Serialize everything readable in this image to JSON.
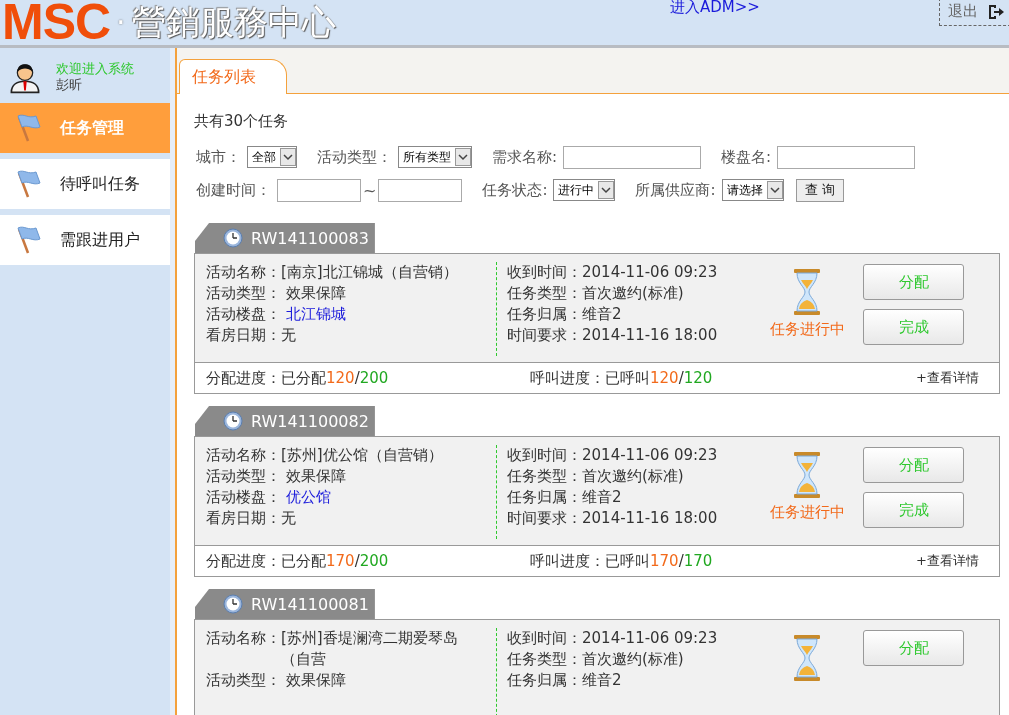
{
  "header": {
    "logo": "MSC",
    "separator": "·",
    "title": "營銷服務中心",
    "adm_link": "进入ADM>>",
    "logout": "退出"
  },
  "user": {
    "welcome": "欢迎进入系统",
    "name": "彭昕"
  },
  "menu": [
    {
      "label": "任务管理",
      "selected": true
    },
    {
      "label": "待呼叫任务",
      "selected": false
    },
    {
      "label": "需跟进用户",
      "selected": false
    }
  ],
  "tab": {
    "label": "任务列表"
  },
  "summary": "共有30个任务",
  "filters": [
    [
      {
        "kind": "select",
        "label": "城市：",
        "value": "全部"
      },
      {
        "kind": "select",
        "label": "活动类型：",
        "value": "所有类型"
      },
      {
        "kind": "input",
        "label": "需求名称:"
      },
      {
        "kind": "input",
        "label": "楼盘名:"
      }
    ],
    [
      {
        "kind": "range",
        "label": "创建时间：",
        "separator": "~"
      },
      {
        "kind": "select",
        "label": "任务状态:",
        "value": "进行中"
      },
      {
        "kind": "select",
        "label": "所属供应商:",
        "value": "请选择"
      },
      {
        "kind": "button",
        "label": "查 询"
      }
    ]
  ],
  "tasks": [
    {
      "id": "RW141100083",
      "left": [
        {
          "label": "活动名称：",
          "value": "[南京]北江锦城（自营销）",
          "link": false
        },
        {
          "label": "活动类型：",
          "value": " 效果保障",
          "link": false
        },
        {
          "label": "活动楼盘：",
          "value": " 北江锦城",
          "link": true
        },
        {
          "label": "看房日期：",
          "value": "无",
          "link": false
        }
      ],
      "right": [
        {
          "label": "收到时间：",
          "value": "2014-11-06 09:23"
        },
        {
          "label": "任务类型：",
          "value": "首次邀约(标准)"
        },
        {
          "label": "任务归属：",
          "value": "维音2"
        },
        {
          "label": "时间要求：",
          "value": "2014-11-16 18:00"
        }
      ],
      "status": "任务进行中",
      "buttons": [
        "分配",
        "完成"
      ],
      "progress": [
        {
          "label": "分配进度：已分配",
          "done": "120",
          "separator": "/",
          "total": "200"
        },
        {
          "label": "呼叫进度：已呼叫",
          "done": "120",
          "separator": "/",
          "total": "120"
        }
      ],
      "detail": "+查看详情"
    },
    {
      "id": "RW141100082",
      "left": [
        {
          "label": "活动名称：",
          "value": "[苏州]优公馆（自营销）",
          "link": false
        },
        {
          "label": "活动类型：",
          "value": " 效果保障",
          "link": false
        },
        {
          "label": "活动楼盘：",
          "value": " 优公馆",
          "link": true
        },
        {
          "label": "看房日期：",
          "value": "无",
          "link": false
        }
      ],
      "right": [
        {
          "label": "收到时间：",
          "value": "2014-11-06 09:23"
        },
        {
          "label": "任务类型：",
          "value": "首次邀约(标准)"
        },
        {
          "label": "任务归属：",
          "value": "维音2"
        },
        {
          "label": "时间要求：",
          "value": "2014-11-16 18:00"
        }
      ],
      "status": "任务进行中",
      "buttons": [
        "分配",
        "完成"
      ],
      "progress": [
        {
          "label": "分配进度：已分配",
          "done": "170",
          "separator": "/",
          "total": "200"
        },
        {
          "label": "呼叫进度：已呼叫",
          "done": "170",
          "separator": "/",
          "total": "170"
        }
      ],
      "detail": "+查看详情"
    },
    {
      "id": "RW141100081",
      "left": [
        {
          "label": "活动名称：",
          "value": "[苏州]香堤澜湾二期爱琴岛（自营",
          "link": false
        },
        {
          "label": "活动类型：",
          "value": " 效果保障",
          "link": false
        }
      ],
      "right": [
        {
          "label": "收到时间：",
          "value": "2014-11-06 09:23"
        },
        {
          "label": "任务类型：",
          "value": "首次邀约(标准)"
        },
        {
          "label": "任务归属：",
          "value": "维音2"
        }
      ],
      "buttons": [
        "分配"
      ]
    }
  ]
}
